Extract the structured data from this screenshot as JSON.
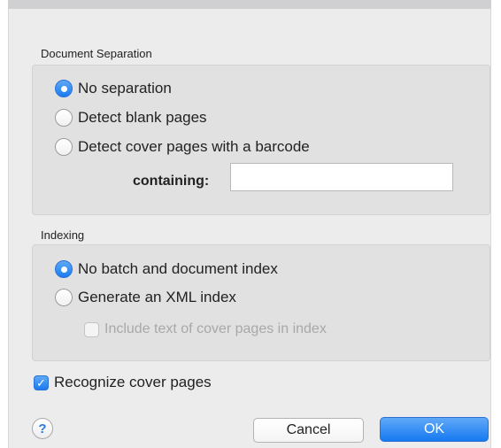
{
  "document_separation": {
    "title": "Document Separation",
    "options": [
      {
        "label": "No separation",
        "selected": true
      },
      {
        "label": "Detect blank pages",
        "selected": false
      },
      {
        "label": "Detect cover pages with a barcode",
        "selected": false
      }
    ],
    "containing_label": "containing:",
    "containing_value": ""
  },
  "indexing": {
    "title": "Indexing",
    "options": [
      {
        "label": "No batch and document index",
        "selected": true
      },
      {
        "label": "Generate an XML index",
        "selected": false
      }
    ],
    "include_cover_text_label": "Include text of cover pages in index",
    "include_cover_text_checked": false,
    "include_cover_text_enabled": false
  },
  "recognize_cover_pages": {
    "label": "Recognize cover pages",
    "checked": true
  },
  "footer": {
    "help_glyph": "?",
    "cancel_label": "Cancel",
    "ok_label": "OK"
  },
  "colors": {
    "accent": "#1a7cf0",
    "sheet_background": "#ececec",
    "group_background": "#e1e1e1",
    "disabled_text": "#a8a8a8"
  }
}
